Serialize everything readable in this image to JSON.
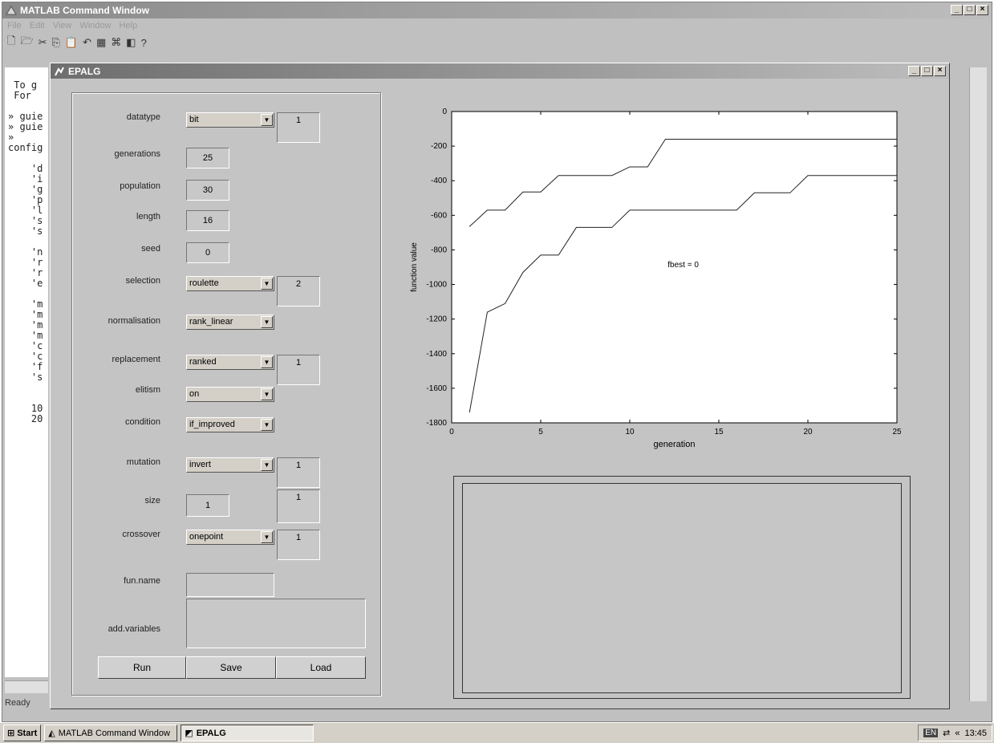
{
  "matlab_window": {
    "title": "MATLAB Command Window",
    "menu": [
      "File",
      "Edit",
      "View",
      "Window",
      "Help"
    ],
    "command_lines": [
      " To g",
      " For",
      "",
      "» guie",
      "» guie",
      "»",
      "config",
      "",
      "    'd",
      "    'i",
      "    'g",
      "    'p",
      "    'l",
      "    's",
      "    's",
      "",
      "    'n",
      "    'r",
      "    'r",
      "    'e",
      "",
      "    'm",
      "    'm",
      "    'm",
      "    'm",
      "    'c",
      "    'c",
      "    'f",
      "    's",
      "",
      "",
      "    10",
      "    20"
    ],
    "status": "Ready"
  },
  "epalg": {
    "title": "EPALG",
    "fields": {
      "datatype": {
        "label": "datatype",
        "value": "bit",
        "extra": "1"
      },
      "generations": {
        "label": "generations",
        "value": "25"
      },
      "population": {
        "label": "population",
        "value": "30"
      },
      "length": {
        "label": "length",
        "value": "16"
      },
      "seed": {
        "label": "seed",
        "value": "0"
      },
      "selection": {
        "label": "selection",
        "value": "roulette",
        "extra": "2"
      },
      "normalisation": {
        "label": "normalisation",
        "value": "rank_linear"
      },
      "replacement": {
        "label": "replacement",
        "value": "ranked",
        "extra": "1"
      },
      "elitism": {
        "label": "elitism",
        "value": "on"
      },
      "condition": {
        "label": "condition",
        "value": "if_improved"
      },
      "mutation": {
        "label": "mutation",
        "value": "invert",
        "extra": "1"
      },
      "size": {
        "label": "size",
        "value": "1",
        "extra": "1"
      },
      "crossover": {
        "label": "crossover",
        "value": "onepoint",
        "extra": "1"
      },
      "fun_name": {
        "label": "fun.name",
        "value": ""
      },
      "add_variables": {
        "label": "add.variables",
        "value": ""
      }
    },
    "buttons": {
      "run": "Run",
      "save": "Save",
      "load": "Load"
    }
  },
  "chart_data": {
    "type": "line",
    "title": "",
    "xlabel": "generation",
    "ylabel": "function value",
    "xlim": [
      0,
      25
    ],
    "ylim": [
      -1800,
      0
    ],
    "xticks": [
      0,
      5,
      10,
      15,
      20,
      25
    ],
    "yticks": [
      0,
      -200,
      -400,
      -600,
      -800,
      -1000,
      -1200,
      -1400,
      -1600,
      -1800
    ],
    "annotation": "fbest = 0",
    "grid": false,
    "series": [
      {
        "x": [
          1,
          2,
          3,
          4,
          5,
          6,
          7,
          8,
          9,
          10,
          11,
          12,
          13,
          14,
          15,
          16,
          17,
          18,
          19,
          20,
          21,
          22,
          23,
          24,
          25
        ],
        "values": [
          -665,
          -570,
          -570,
          -465,
          -465,
          -370,
          -370,
          -370,
          -370,
          -320,
          -320,
          -160,
          -160,
          -160,
          -160,
          -160,
          -160,
          -160,
          -160,
          -160,
          -160,
          -160,
          -160,
          -160,
          -160
        ]
      },
      {
        "x": [
          1,
          2,
          3,
          4,
          5,
          6,
          7,
          8,
          9,
          10,
          11,
          12,
          13,
          14,
          15,
          16,
          17,
          18,
          19,
          20,
          21,
          22,
          23,
          24,
          25
        ],
        "values": [
          -1740,
          -1160,
          -1110,
          -930,
          -830,
          -830,
          -670,
          -670,
          -670,
          -570,
          -570,
          -570,
          -570,
          -570,
          -570,
          -570,
          -470,
          -470,
          -470,
          -370,
          -370,
          -370,
          -370,
          -370,
          -370
        ]
      }
    ]
  },
  "taskbar": {
    "start": "Start",
    "items": [
      "MATLAB Command Window",
      "EPALG"
    ],
    "lang": "EN",
    "clock": "13:45"
  }
}
